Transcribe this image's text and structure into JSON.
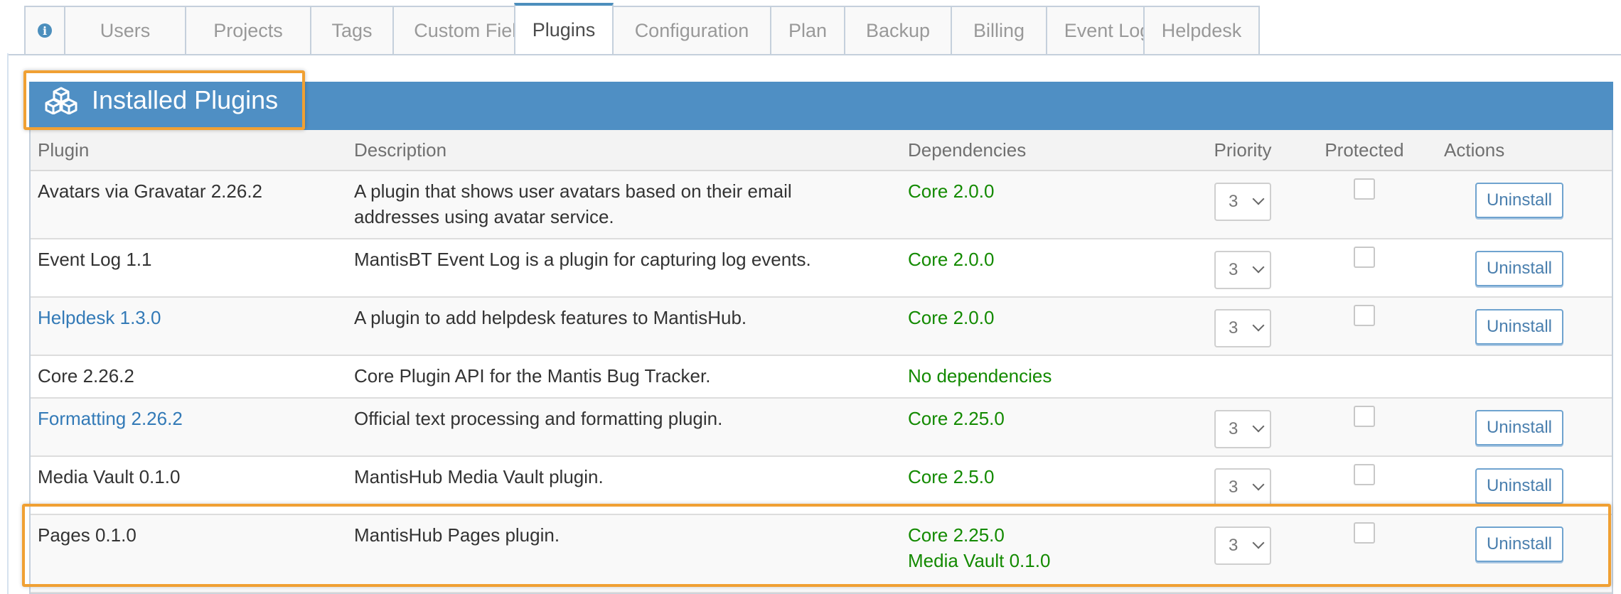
{
  "tabs": [
    {
      "label": "",
      "icon": "info-icon",
      "active": false
    },
    {
      "label": "Users",
      "active": false
    },
    {
      "label": "Projects",
      "active": false
    },
    {
      "label": "Tags",
      "active": false
    },
    {
      "label": "Custom Fields",
      "active": false
    },
    {
      "label": "Plugins",
      "active": true
    },
    {
      "label": "Configuration",
      "active": false
    },
    {
      "label": "Plan",
      "active": false
    },
    {
      "label": "Backup",
      "active": false
    },
    {
      "label": "Billing",
      "active": false
    },
    {
      "label": "Event Log",
      "active": false
    },
    {
      "label": "Helpdesk",
      "active": false
    }
  ],
  "info_glyph": "i",
  "widget": {
    "title": "Installed Plugins",
    "icon": "cubes-icon"
  },
  "table": {
    "headers": {
      "plugin": "Plugin",
      "description": "Description",
      "dependencies": "Dependencies",
      "priority": "Priority",
      "protected": "Protected",
      "actions": "Actions"
    },
    "rows": [
      {
        "name": "Avatars via Gravatar 2.26.2",
        "link": false,
        "description": [
          "A plugin that shows user avatars based on their email",
          "addresses using avatar service."
        ],
        "dependencies": [
          "Core 2.0.0"
        ],
        "priority": "3",
        "protected": false,
        "action": "Uninstall"
      },
      {
        "name": "Event Log 1.1",
        "link": false,
        "description": [
          "MantisBT Event Log is a plugin for capturing log events."
        ],
        "dependencies": [
          "Core 2.0.0"
        ],
        "priority": "3",
        "protected": false,
        "action": "Uninstall"
      },
      {
        "name": "Helpdesk 1.3.0",
        "link": true,
        "description": [
          "A plugin to add helpdesk features to MantisHub."
        ],
        "dependencies": [
          "Core 2.0.0"
        ],
        "priority": "3",
        "protected": false,
        "action": "Uninstall"
      },
      {
        "name": "Core 2.26.2",
        "link": false,
        "description": [
          "Core Plugin API for the Mantis Bug Tracker."
        ],
        "dependencies": [
          "No dependencies"
        ],
        "priority": null,
        "protected": null,
        "action": null
      },
      {
        "name": "Formatting 2.26.2",
        "link": true,
        "description": [
          "Official text processing and formatting plugin."
        ],
        "dependencies": [
          "Core 2.25.0"
        ],
        "priority": "3",
        "protected": false,
        "action": "Uninstall"
      },
      {
        "name": "Media Vault 0.1.0",
        "link": false,
        "description": [
          "MantisHub Media Vault plugin."
        ],
        "dependencies": [
          "Core 2.5.0"
        ],
        "priority": "3",
        "protected": false,
        "action": "Uninstall"
      },
      {
        "name": "Pages 0.1.0",
        "link": false,
        "description": [
          "MantisHub Pages plugin."
        ],
        "dependencies": [
          "Core 2.25.0",
          "Media Vault 0.1.0"
        ],
        "priority": "3",
        "protected": false,
        "action": "Uninstall",
        "highlighted": true
      }
    ]
  },
  "colors": {
    "header_bg": "#4f8fc4",
    "highlight": "#f0a033",
    "link": "#337ab7",
    "dependency_ok": "#138a00"
  }
}
